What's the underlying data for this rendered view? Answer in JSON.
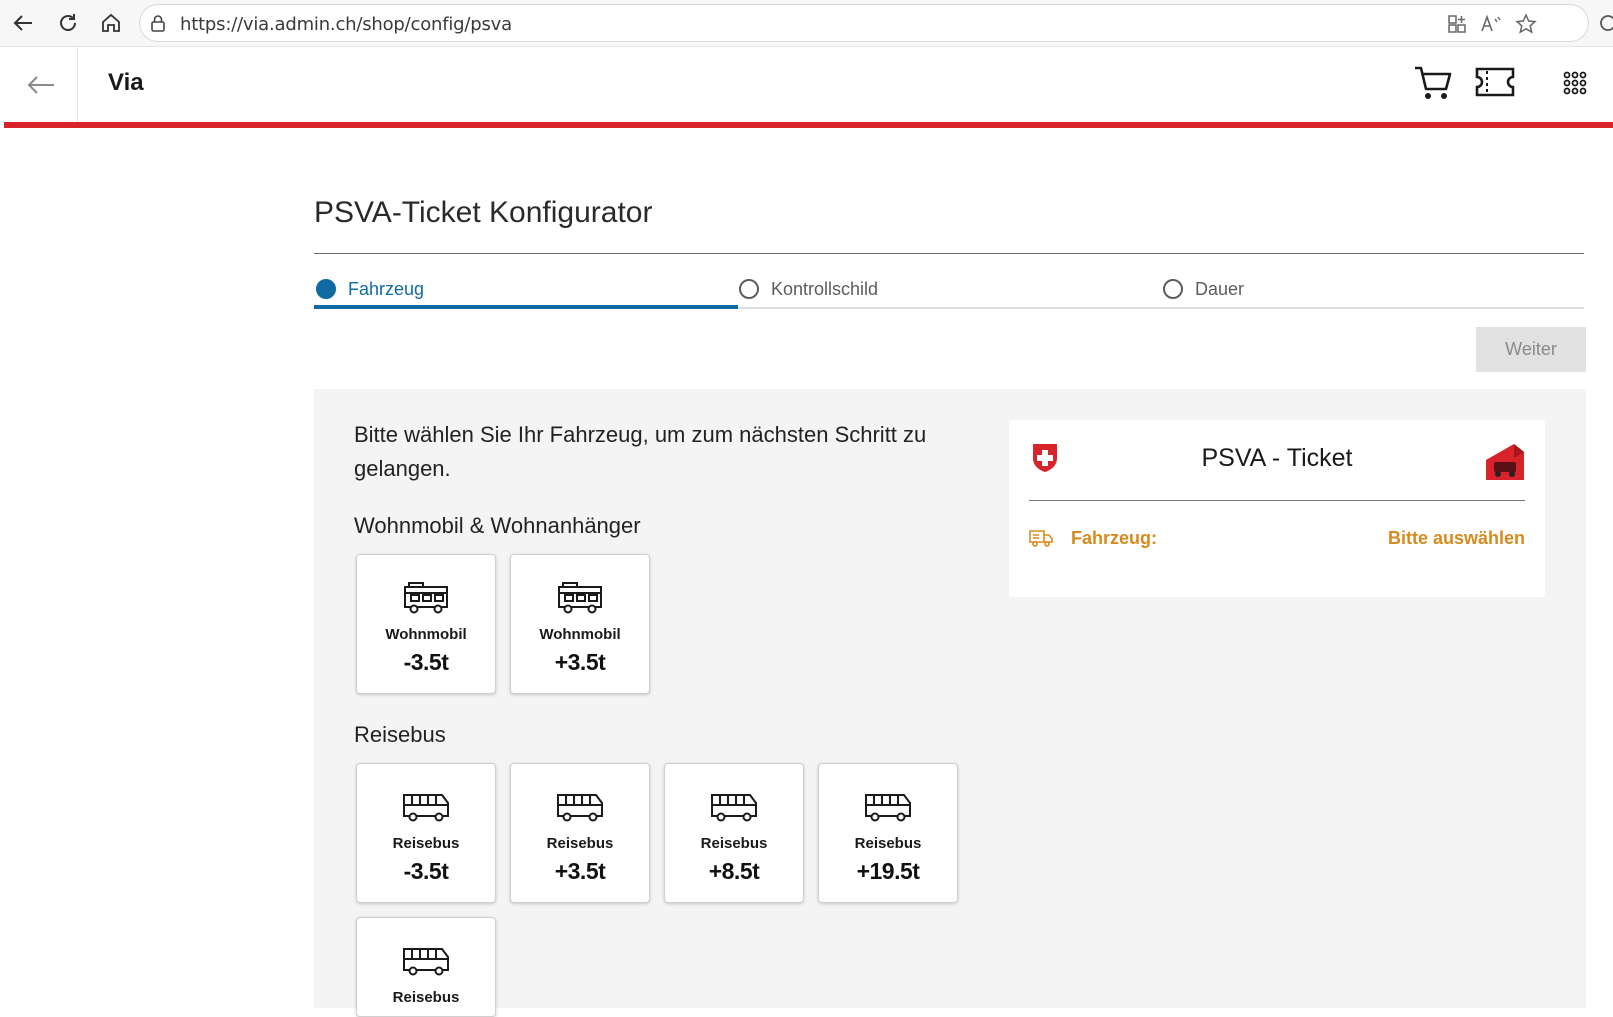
{
  "browser": {
    "url": "https://via.admin.ch/shop/config/psva",
    "icons": [
      "back-arrow-icon",
      "reload-icon",
      "home-icon",
      "lock-icon",
      "app-grid-icon",
      "read-aloud-icon",
      "favorite-star-icon",
      "extensions-icon"
    ]
  },
  "header": {
    "title": "Via",
    "icons": [
      "back-arrow-icon",
      "cart-icon",
      "ticket-icon",
      "apps-grid-icon"
    ],
    "accent_color": "#d8232a"
  },
  "page": {
    "title": "PSVA-Ticket Konfigurator",
    "steps": [
      {
        "label": "Fahrzeug",
        "active": true
      },
      {
        "label": "Kontrollschild",
        "active": false
      },
      {
        "label": "Dauer",
        "active": false
      }
    ],
    "step_color": "#106ba3",
    "next_button": "Weiter",
    "instruction": "Bitte wählen Sie Ihr Fahrzeug, um zum nächsten Schritt zu gelangen."
  },
  "groups": [
    {
      "title": "Wohnmobil & Wohnanhänger",
      "icon": "camper-icon",
      "items": [
        {
          "name": "Wohnmobil",
          "weight": "-3.5t"
        },
        {
          "name": "Wohnmobil",
          "weight": "+3.5t"
        }
      ]
    },
    {
      "title": "Reisebus",
      "icon": "bus-icon",
      "items": [
        {
          "name": "Reisebus",
          "weight": "-3.5t"
        },
        {
          "name": "Reisebus",
          "weight": "+3.5t"
        },
        {
          "name": "Reisebus",
          "weight": "+8.5t"
        },
        {
          "name": "Reisebus",
          "weight": "+19.5t"
        },
        {
          "name": "Reisebus",
          "weight": ""
        }
      ]
    }
  ],
  "summary": {
    "title": "PSVA - Ticket",
    "field_label": "Fahrzeug:",
    "field_value": "Bitte auswählen",
    "highlight_color": "#d78b1e",
    "icons": [
      "swiss-shield-icon",
      "ticket-vehicle-icon",
      "truck-icon"
    ]
  }
}
